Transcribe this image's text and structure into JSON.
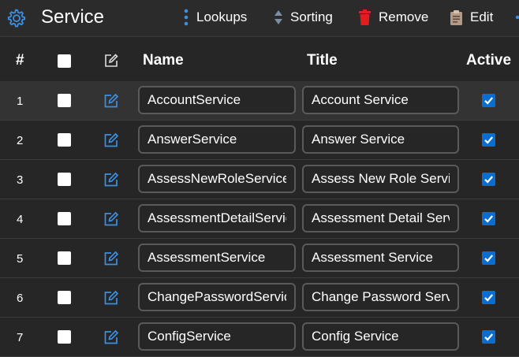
{
  "header": {
    "title": "Service",
    "lookups_label": "Lookups",
    "sorting_label": "Sorting",
    "remove_label": "Remove",
    "edit_label": "Edit"
  },
  "colors": {
    "accent": "#3d8fe0",
    "remove_red": "#e01e1e",
    "checkbox_blue": "#0a6ed1"
  },
  "table": {
    "columns": {
      "num": "#",
      "name": "Name",
      "title": "Title",
      "active": "Active"
    },
    "rows": [
      {
        "num": "1",
        "name": "AccountService",
        "title": "Account Service",
        "active": true,
        "selected": true
      },
      {
        "num": "2",
        "name": "AnswerService",
        "title": "Answer Service",
        "active": true
      },
      {
        "num": "3",
        "name": "AssessNewRoleService",
        "title": "Assess New Role Service",
        "active": true
      },
      {
        "num": "4",
        "name": "AssessmentDetailService",
        "title": "Assessment Detail Service",
        "active": true
      },
      {
        "num": "5",
        "name": "AssessmentService",
        "title": "Assessment Service",
        "active": true
      },
      {
        "num": "6",
        "name": "ChangePasswordService",
        "title": "Change Password Service",
        "active": true
      },
      {
        "num": "7",
        "name": "ConfigService",
        "title": "Config Service",
        "active": true
      }
    ]
  }
}
